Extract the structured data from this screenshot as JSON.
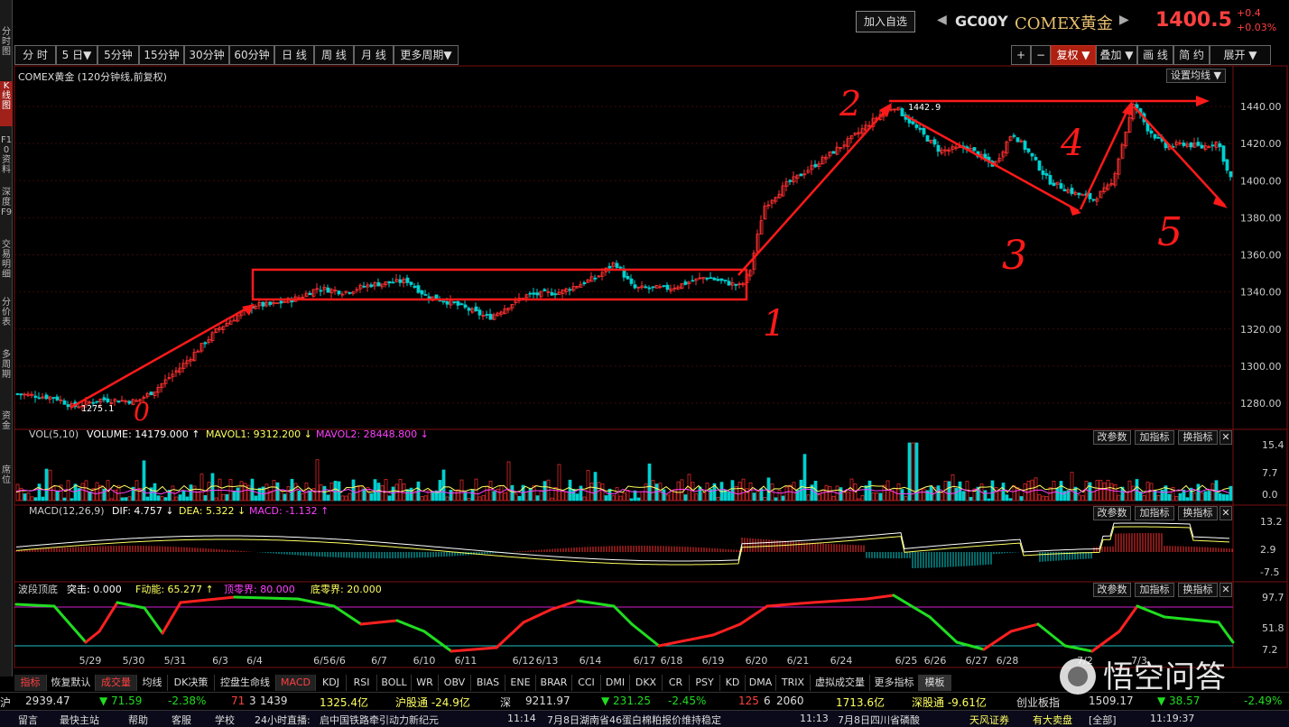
{
  "sidebar": {
    "items": [
      "分时图",
      "K线图",
      "F10资料",
      "深度F9",
      "交易明细",
      "分价表",
      "多周期",
      "资金",
      "席位"
    ]
  },
  "header": {
    "add_watch": "加入自选",
    "code": "GC00Y",
    "name": "COMEX黄金",
    "last": "1400.5",
    "change": "+0.4",
    "change_pct": "+0.03%"
  },
  "toolbar": {
    "left": [
      "分 时",
      "5 日▼",
      "5分钟",
      "15分钟",
      "30分钟",
      "60分钟",
      "日 线",
      "周 线",
      "月 线",
      "更多周期▼"
    ],
    "right": [
      "+",
      "−",
      "复权 ▼",
      "叠加 ▼",
      "画 线",
      "简 约",
      "展开 ▼"
    ]
  },
  "main_chart": {
    "title": "COMEX黄金 (120分钟线,前复权)",
    "setting": "设置均线 ▼",
    "y_ticks": [
      "1440.00",
      "1420.00",
      "1400.00",
      "1380.00",
      "1360.00",
      "1340.00",
      "1320.00",
      "1300.00",
      "1280.00"
    ],
    "low_label": "1275.1",
    "high_label": "1442.9",
    "annotations": [
      "0",
      "1",
      "2",
      "3",
      "4",
      "5"
    ]
  },
  "vol": {
    "label": "VOL(5,10)",
    "volume": "VOLUME: 14179.000 ↑",
    "mavol1": "MAVOL1: 9312.200 ↓",
    "mavol2": "MAVOL2: 28448.800 ↓",
    "y_ticks": [
      "15.4",
      "7.7",
      "0.0"
    ]
  },
  "macd": {
    "label": "MACD(12,26,9)",
    "dif": "DIF: 4.757 ↓",
    "dea": "DEA: 5.322 ↓",
    "macd": "MACD: -1.132 ↑",
    "y_ticks": [
      "13.2",
      "2.9",
      "-7.5"
    ]
  },
  "wave": {
    "label": "波段顶底",
    "tupo": "突击: 0.000",
    "fdong": "F动能: 65.277 ↑",
    "top": "顶零界: 80.000",
    "bottom": "底零界: 20.000",
    "y_ticks": [
      "97.7",
      "51.8",
      "7.2"
    ]
  },
  "panel_buttons": [
    "改参数",
    "加指标",
    "换指标",
    "✕"
  ],
  "x_labels": [
    "5/29",
    "5/30",
    "5/31",
    "6/3",
    "6/4",
    "6/5",
    "6/6",
    "6/7",
    "6/10",
    "6/11",
    "6/12",
    "6/13",
    "6/14",
    "6/17",
    "6/18",
    "6/19",
    "6/20",
    "6/21",
    "6/24",
    "6/25",
    "6/26",
    "6/27",
    "6/28",
    "7/2",
    "7/3"
  ],
  "bottom_tabs": [
    "指标",
    "恢复默认",
    "成交量",
    "均线",
    "DK决策",
    "控盘生命线",
    "MACD",
    "KDJ",
    "RSI",
    "BOLL",
    "WR",
    "OBV",
    "BIAS",
    "ENE",
    "BRAR",
    "CCI",
    "DMI",
    "DKX",
    "CR",
    "PSY",
    "KD",
    "DMA",
    "TRIX",
    "虚拟成交量",
    "更多指标",
    "模板"
  ],
  "status1": {
    "sh_label": "沪",
    "sh_index": "2939.47",
    "sh_chg": "▼ 71.59",
    "sh_pct": "-2.38%",
    "sh_updn": "71",
    "sh_flat": "3",
    "sh_cnt": "1439",
    "sh_amt": "1325.4亿",
    "hgt": "沪股通 -24.9亿",
    "sz_label": "深",
    "sz_index": "9211.97",
    "sz_chg": "▼ 231.25",
    "sz_pct": "-2.45%",
    "sz_updn": "125",
    "sz_flat": "6",
    "sz_cnt": "2060",
    "sz_amt": "1713.6亿",
    "sgt": "深股通 -9.61亿",
    "cyb": "创业板指",
    "cyb_idx": "1509.17",
    "cyb_chg": "▼ 38.57",
    "cyb_pct": "-2.49%"
  },
  "status2": {
    "items": [
      "留言",
      "最快主站",
      "帮助",
      "客服",
      "学校",
      "24小时直播:",
      "启中国铁路牵引动力新纪元",
      "11:14",
      "7月8日湖南省46蛋白棉粕报价维持稳定",
      "11:13",
      "7月8日四川省磷酸",
      "天风证券",
      "有大卖盘",
      "[全部]",
      "11:19:37"
    ]
  },
  "watermark": "悟空问答",
  "colors": {
    "up": "#ff3030",
    "down": "#00d0d0",
    "dif": "#ffffff",
    "dea": "#ffff60",
    "wave_up": "#ff2020",
    "wave_dn": "#20dd20",
    "top_line": "#d020d0",
    "bot_line": "#20c0c0",
    "annot": "#ff1a1a"
  }
}
